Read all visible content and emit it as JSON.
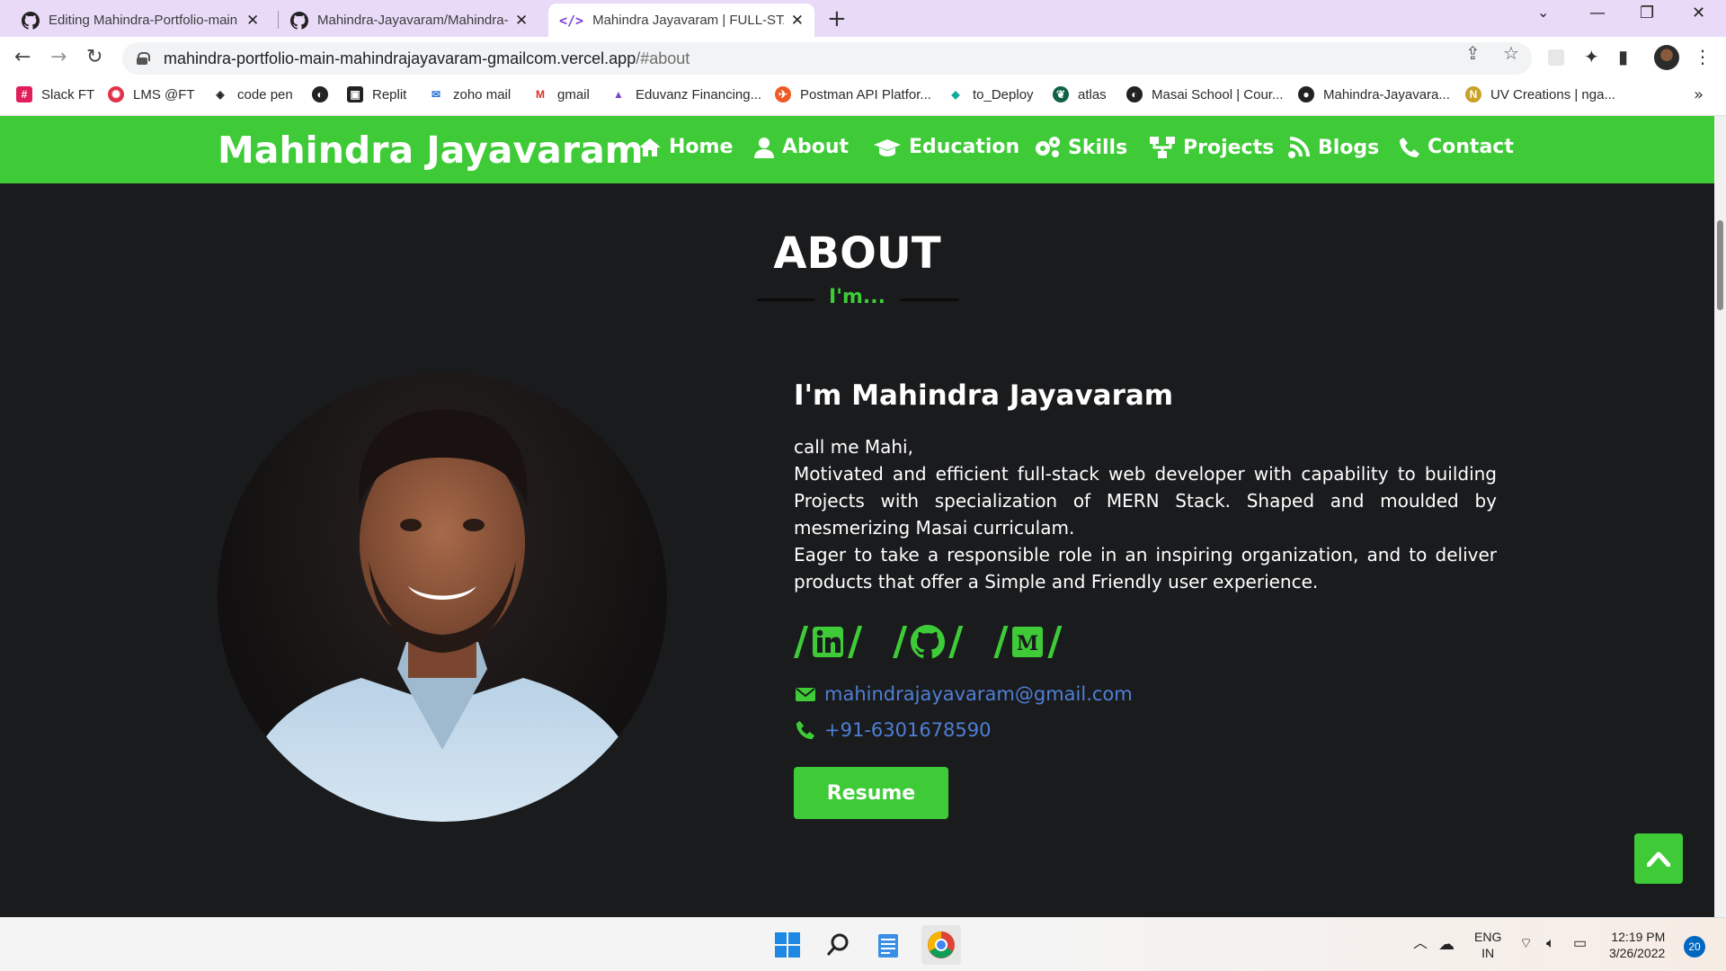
{
  "browser": {
    "tabs": [
      {
        "title": "Editing Mahindra-Portfolio-main",
        "icon": "github-icon",
        "active": false
      },
      {
        "title": "Mahindra-Jayavaram/Mahindra-P",
        "icon": "github-icon",
        "active": false
      },
      {
        "title": "Mahindra Jayavaram | FULL-STAC",
        "icon": "code-icon",
        "active": true
      }
    ],
    "url_main": "mahindra-portfolio-main-mahindrajayavaram-gmailcom.vercel.app",
    "url_rest": "/#about",
    "bookmarks": [
      {
        "label": "Slack FT",
        "icon": "slack-icon",
        "color": "#e01e5a"
      },
      {
        "label": "LMS @FT",
        "icon": "lms-icon",
        "color": "#e0334a"
      },
      {
        "label": "code pen",
        "icon": "codepen-icon",
        "color": "#222222"
      },
      {
        "label": "",
        "icon": "globe-icon",
        "color": "#222222"
      },
      {
        "label": "Replit",
        "icon": "replit-icon",
        "color": "#222222"
      },
      {
        "label": "zoho mail",
        "icon": "zoho-icon",
        "color": "#2a6fd6"
      },
      {
        "label": "gmail",
        "icon": "gmail-icon",
        "color": "#d93025"
      },
      {
        "label": "Eduvanz Financing...",
        "icon": "eduvanz-icon",
        "color": "#7a48c9"
      },
      {
        "label": "Postman API Platfor...",
        "icon": "postman-icon",
        "color": "#ef5b25"
      },
      {
        "label": "to_Deploy",
        "icon": "diamond-icon",
        "color": "#13a89e"
      },
      {
        "label": "atlas",
        "icon": "mongodb-icon",
        "color": "#116149"
      },
      {
        "label": "Masai School | Cour...",
        "icon": "globe-icon",
        "color": "#222222"
      },
      {
        "label": "Mahindra-Jayavara...",
        "icon": "github-icon",
        "color": "#222222"
      },
      {
        "label": "UV Creations | nga...",
        "icon": "uv-icon",
        "color": "#c9a227"
      }
    ]
  },
  "site": {
    "brand": "Mahindra Jayavaram",
    "nav": [
      {
        "label": "Home",
        "icon": "home-icon"
      },
      {
        "label": "About",
        "icon": "user-icon"
      },
      {
        "label": "Education",
        "icon": "graduation-cap-icon"
      },
      {
        "label": "Skills",
        "icon": "gears-icon"
      },
      {
        "label": "Projects",
        "icon": "sitemap-icon"
      },
      {
        "label": "Blogs",
        "icon": "blog-icon"
      },
      {
        "label": "Contact",
        "icon": "phone-icon"
      }
    ],
    "accent": "#3ecb37",
    "background": "#1a1b1d"
  },
  "about": {
    "title": "ABOUT",
    "subtitle": "I'm...",
    "name": "I'm Mahindra Jayavaram",
    "line1": "call me Mahi,",
    "line2": "Motivated and efficient full-stack web developer with capability to building Projects with specialization of MERN Stack. Shaped and moulded by mesmerizing Masai curriculam.",
    "line3": "Eager to take a responsible role in an inspiring organization, and to deliver products that offer a Simple and Friendly user experience.",
    "socials": [
      "linkedin-icon",
      "github-icon",
      "medium-icon"
    ],
    "email": "mahindrajayavaram@gmail.com",
    "phone": "+91-6301678590",
    "resume": "Resume",
    "link_color": "#4f7fd6"
  },
  "taskbar": {
    "lang_top": "ENG",
    "lang_bottom": "IN",
    "time": "12:19 PM",
    "date": "3/26/2022",
    "notifications": "20"
  }
}
